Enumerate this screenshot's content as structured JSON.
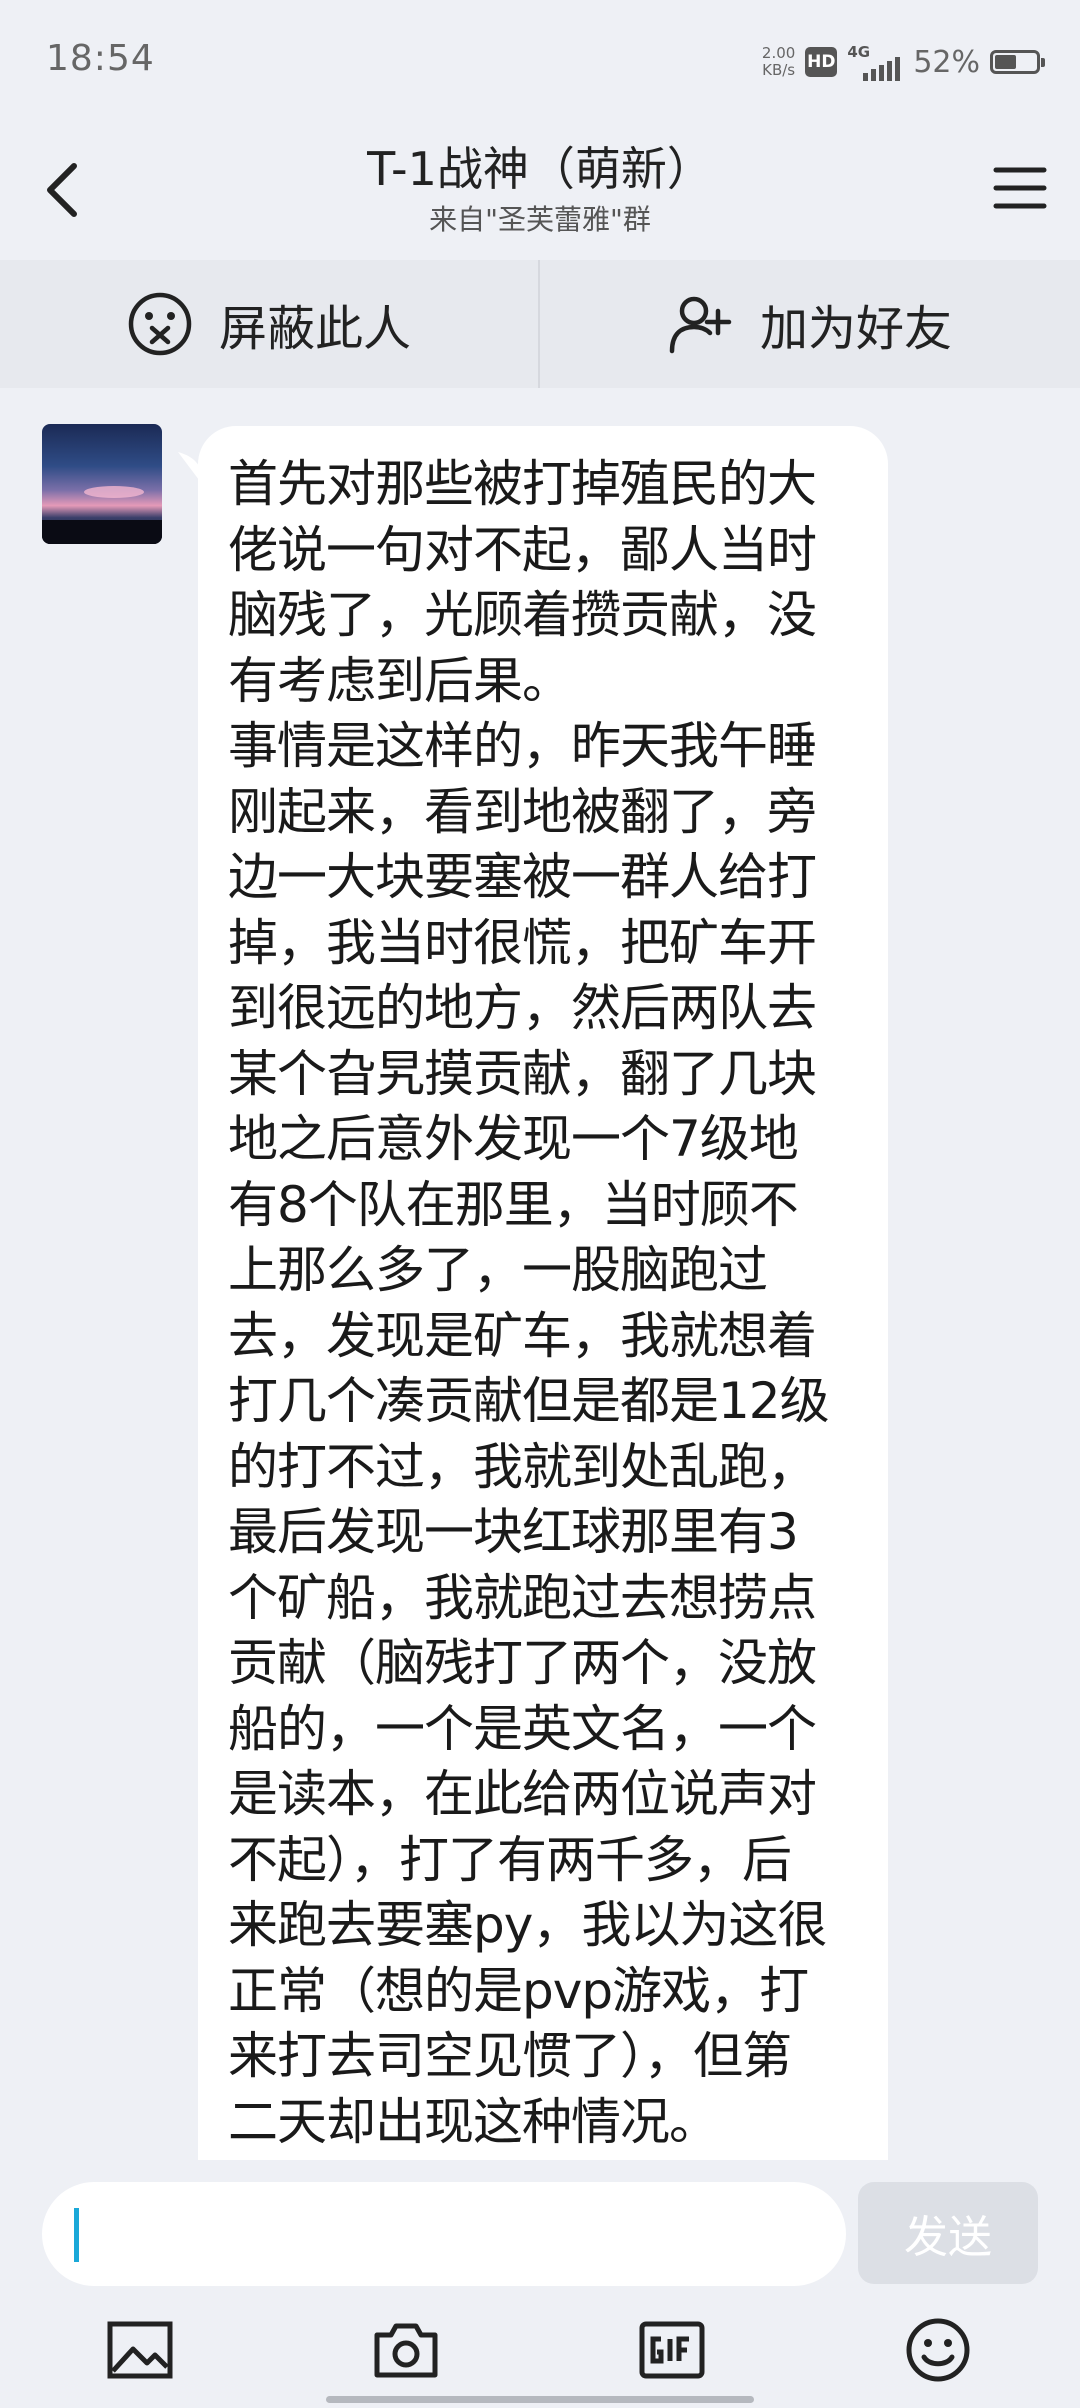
{
  "status_bar": {
    "time": "18:54",
    "net_speed_value": "2.00",
    "net_speed_unit": "KB/s",
    "hd_badge": "HD",
    "network": "4G",
    "battery_percent": "52%",
    "battery_level": 0.52
  },
  "header": {
    "title": "T-1战神（萌新）",
    "subtitle": "来自\"圣芙蕾雅\"群",
    "back_icon": "chevron-left-icon",
    "menu_icon": "hamburger-menu-icon"
  },
  "actions": {
    "block_label": "屏蔽此人",
    "block_icon": "sad-face-icon",
    "add_friend_label": "加为好友",
    "add_friend_icon": "add-user-icon"
  },
  "message": {
    "lines": [
      "首先对那些被打掉殖民的大",
      "佬说一句对不起，鄙人当时",
      "脑残了，光顾着攒贡献，没",
      "有考虑到后果。",
      "事情是这样的，昨天我午睡",
      "刚起来，看到地被翻了，旁",
      "边一大块要塞被一群人给打",
      "掉，我当时很慌，把矿车开",
      "到很远的地方，然后两队去",
      "某个旮旯摸贡献，翻了几块",
      "地之后意外发现一个7级地",
      "有8个队在那里，当时顾不",
      "上那么多了，一股脑跑过",
      "去，发现是矿车，我就想着",
      "打几个凑贡献但是都是12级",
      "的打不过，我就到处乱跑，",
      "最后发现一块红球那里有3",
      "个矿船，我就跑过去想捞点",
      "贡献（脑残打了两个，没放",
      "船的，一个是英文名，一个",
      "是读本，在此给两位说声对",
      "不起），打了有两千多，后",
      "来跑去要塞py，我以为这很",
      "正常（想的是pvp游戏，打",
      "来打去司空见惯了），但第",
      "二天却出现这种情况。"
    ]
  },
  "composer": {
    "input_value": "",
    "send_label": "发送"
  },
  "toolbar": {
    "icons": [
      "image-icon",
      "camera-icon",
      "gif-icon",
      "emoji-icon"
    ]
  },
  "colors": {
    "background": "#eef0f5",
    "action_bar": "#e7e9ee",
    "bubble": "#ffffff",
    "caret": "#1aa8d8",
    "send_button": "#dcdfe5"
  }
}
